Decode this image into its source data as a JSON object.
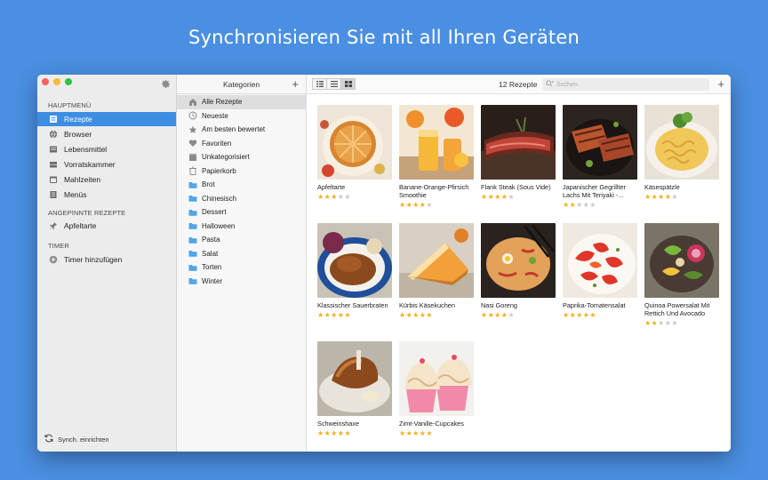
{
  "headline": "Synchronisieren Sie mit all Ihren Geräten",
  "colors": {
    "accent": "#3d8ee3",
    "background": "#4a8fe2",
    "star": "#f3ad1c"
  },
  "sidebar": {
    "main_section": "HAUPTMENÜ",
    "items": [
      {
        "label": "Rezepte",
        "icon": "recipes-icon",
        "active": true
      },
      {
        "label": "Browser",
        "icon": "globe-icon"
      },
      {
        "label": "Lebensmittel",
        "icon": "cart-icon"
      },
      {
        "label": "Vorratskammer",
        "icon": "pantry-icon"
      },
      {
        "label": "Mahlzeiten",
        "icon": "calendar-icon"
      },
      {
        "label": "Menüs",
        "icon": "menu-book-icon"
      }
    ],
    "pinned_section": "ANGEPINNTE REZEPTE",
    "pinned": [
      {
        "label": "Apfeltarte",
        "icon": "pin-icon"
      }
    ],
    "timer_section": "TIMER",
    "add_timer": "Timer hinzufügen",
    "sync": "Synch. einrichten"
  },
  "categories": {
    "title": "Kategorien",
    "add": "+",
    "items": [
      {
        "label": "Alle Rezepte",
        "icon": "house-icon",
        "active": true
      },
      {
        "label": "Neueste",
        "icon": "clock-icon"
      },
      {
        "label": "Am besten bewertet",
        "icon": "star-icon"
      },
      {
        "label": "Favoriten",
        "icon": "heart-icon"
      },
      {
        "label": "Unkategorisiert",
        "icon": "box-icon"
      },
      {
        "label": "Papierkorb",
        "icon": "trash-icon"
      },
      {
        "label": "Brot",
        "icon": "folder-icon"
      },
      {
        "label": "Chinesisch",
        "icon": "folder-icon"
      },
      {
        "label": "Dessert",
        "icon": "folder-icon"
      },
      {
        "label": "Halloween",
        "icon": "folder-icon"
      },
      {
        "label": "Pasta",
        "icon": "folder-icon"
      },
      {
        "label": "Salat",
        "icon": "folder-icon"
      },
      {
        "label": "Torten",
        "icon": "folder-icon"
      },
      {
        "label": "Winter",
        "icon": "folder-icon"
      }
    ]
  },
  "toolbar": {
    "count": "12 Rezepte",
    "search_placeholder": "Suchen",
    "add": "+",
    "views": [
      "list-view-icon",
      "compact-list-icon",
      "grid-view-icon"
    ],
    "selected_view": 2
  },
  "recipes": [
    {
      "title": "Apfeltarte",
      "rating": 3
    },
    {
      "title": "Banane-Orange-Pfirsich Smoothie",
      "rating": 4
    },
    {
      "title": "Flank Steak (Sous Vide)",
      "rating": 4
    },
    {
      "title": "Japanischer Gegrillter Lachs Mit Teriyaki -...",
      "rating": 2
    },
    {
      "title": "Käsespätzle",
      "rating": 4
    },
    {
      "title": "Klassischer Sauerbraten",
      "rating": 5
    },
    {
      "title": "Kürbis Käsekuchen",
      "rating": 5
    },
    {
      "title": "Nasi Goreng",
      "rating": 4
    },
    {
      "title": "Paprika-Tomatensalat",
      "rating": 5
    },
    {
      "title": "Quinoa Powersalat Mit Rettich Und Avocado",
      "rating": 2
    },
    {
      "title": "Schweinshaxe",
      "rating": 5
    },
    {
      "title": "Zimt-Vanille-Cupcakes",
      "rating": 5
    }
  ]
}
